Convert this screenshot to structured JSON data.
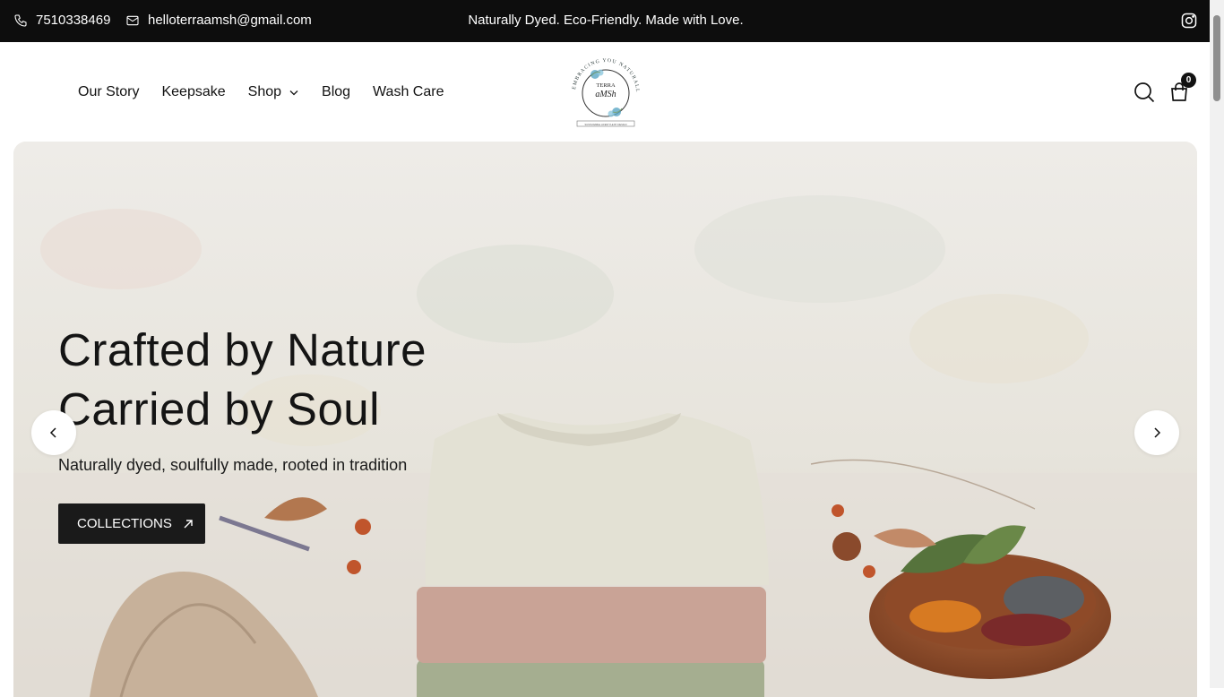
{
  "topbar": {
    "phone": "7510338469",
    "email": "helloterraamsh@gmail.com",
    "announcement": "Naturally Dyed. Eco-Friendly. Made with Love."
  },
  "nav": {
    "items": [
      "Our Story",
      "Keepsake",
      "Shop",
      "Blog",
      "Wash Care"
    ]
  },
  "logo": {
    "arc_text": "EMBRACING YOU NATURALLY",
    "brand_line1": "TERRA",
    "brand_line2": "aMSh",
    "tagline": "SUSTAINABLE LIFESTYLE BY DESIGN"
  },
  "cart": {
    "count": "0"
  },
  "hero": {
    "title_line1": "Crafted by Nature",
    "title_line2": "Carried by Soul",
    "subtitle": "Naturally dyed, soulfully made, rooted in tradition",
    "button_label": "COLLECTIONS"
  },
  "icons": [
    "phone-icon",
    "mail-icon",
    "instagram-icon",
    "chevron-down-icon",
    "search-icon",
    "cart-icon",
    "arrow-up-right-icon",
    "chevron-left-icon",
    "chevron-right-icon"
  ],
  "colors": {
    "topbar_bg": "#0d0d0d",
    "button_bg": "#1a1a1a",
    "text": "#121212"
  }
}
